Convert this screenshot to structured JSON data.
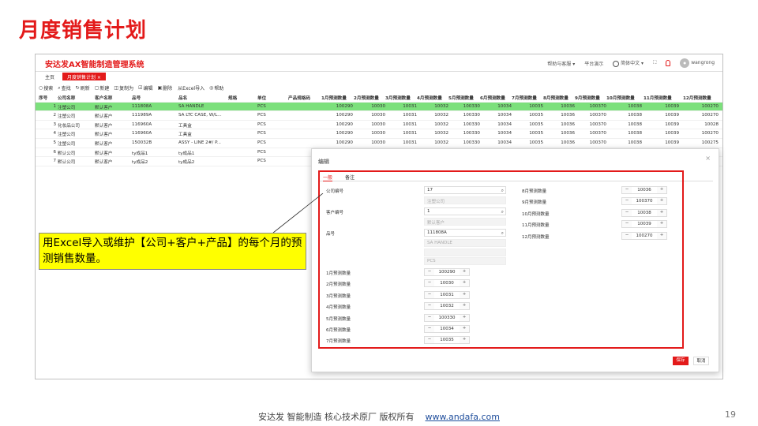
{
  "slide_title": "月度销售计划",
  "app": {
    "name": "安达发AX智能制造管理系统",
    "top_right": {
      "help": "帮助与客服 ▾",
      "platform": "平台演示",
      "lang": "简体中文 ▾",
      "user": "wangrong"
    },
    "tabs": [
      {
        "label": "主页"
      },
      {
        "label": "月度销售计划  ×"
      }
    ],
    "toolbar": [
      "搜索",
      "查找",
      "刷新",
      "新建",
      "复制为",
      "编辑",
      "删除",
      "从Excel导入",
      "帮助"
    ],
    "toolbar_icons": [
      "○",
      "⌕",
      "↻",
      "▢",
      "◫",
      "☑",
      "▣",
      "",
      "◎"
    ],
    "columns": [
      "序号",
      "公司名称",
      "客户名称",
      "品号",
      "品名",
      "规格",
      "单位",
      "产品规格码",
      "1月预测数量",
      "2月预测数量",
      "3月预测数量",
      "4月预测数量",
      "5月预测数量",
      "6月预测数量",
      "7月预测数量",
      "8月预测数量",
      "9月预测数量",
      "10月预测数量",
      "11月预测数量",
      "12月预测数量"
    ],
    "rows": [
      [
        "1",
        "注塑公司",
        "默认客户",
        "111808A",
        "SA HANDLE",
        "",
        "PCS",
        "",
        "100290",
        "10030",
        "10031",
        "10032",
        "100330",
        "10034",
        "10035",
        "10036",
        "100370",
        "10038",
        "10039",
        "100270"
      ],
      [
        "2",
        "注塑公司",
        "默认客户",
        "111989A",
        "SA LTC CASE, W/L...",
        "",
        "PCS",
        "",
        "100290",
        "10030",
        "10031",
        "10032",
        "100330",
        "10034",
        "10035",
        "10036",
        "100370",
        "10038",
        "10039",
        "100270"
      ],
      [
        "3",
        "化妆品公司",
        "默认客户",
        "116960A",
        "工具盒",
        "",
        "PCS",
        "",
        "100290",
        "10030",
        "10031",
        "10032",
        "100330",
        "10034",
        "10035",
        "10036",
        "100370",
        "10038",
        "10039",
        "10028"
      ],
      [
        "4",
        "注塑公司",
        "默认客户",
        "116960A",
        "工具盒",
        "",
        "PCS",
        "",
        "100290",
        "10030",
        "10031",
        "10032",
        "100330",
        "10034",
        "10035",
        "10036",
        "100370",
        "10038",
        "10039",
        "100270"
      ],
      [
        "5",
        "注塑公司",
        "默认客户",
        "150032B",
        "ASSY - LINE 2#/ P...",
        "",
        "PCS",
        "",
        "100290",
        "10030",
        "10031",
        "10032",
        "100330",
        "10034",
        "10035",
        "10036",
        "100370",
        "10038",
        "10039",
        "100275"
      ],
      [
        "6",
        "默认公司",
        "默认客户",
        "ty成品1",
        "ty成品1",
        "",
        "PCS",
        "",
        "",
        "",
        "",
        "",
        "",
        "",
        "",
        "",
        "",
        "",
        "",
        ""
      ],
      [
        "7",
        "默认公司",
        "默认客户",
        "ty成品2",
        "ty成品2",
        "",
        "PCS",
        "",
        "",
        "",
        "",
        "",
        "",
        "",
        "",
        "",
        "",
        "",
        "",
        ""
      ]
    ]
  },
  "dialog": {
    "title": "编辑",
    "close": "×",
    "tabs": [
      "一般",
      "备注"
    ],
    "company_label": "公司编号",
    "company_value": "17",
    "company_name": "注塑公司",
    "customer_label": "客户编号",
    "customer_value": "1",
    "customer_name": "默认客户",
    "item_label": "品号",
    "item_value": "111808A",
    "item_name": "SA HANDLE",
    "item_spec": "",
    "item_unit": "PCS",
    "months_left": [
      {
        "label": "1月预测数量",
        "value": "100290"
      },
      {
        "label": "2月预测数量",
        "value": "10030"
      },
      {
        "label": "3月预测数量",
        "value": "10031"
      },
      {
        "label": "4月预测数量",
        "value": "10032"
      },
      {
        "label": "5月预测数量",
        "value": "100330"
      },
      {
        "label": "6月预测数量",
        "value": "10034"
      },
      {
        "label": "7月预测数量",
        "value": "10035"
      }
    ],
    "months_right": [
      {
        "label": "8月预测数量",
        "value": "10036"
      },
      {
        "label": "9月预测数量",
        "value": "100370"
      },
      {
        "label": "10月预测数量",
        "value": "10038"
      },
      {
        "label": "11月预测数量",
        "value": "10039"
      },
      {
        "label": "12月预测数量",
        "value": "100270"
      }
    ],
    "save": "保存",
    "cancel": "取消"
  },
  "callout": "用Excel导入或维护【公司+客户+产品】的每个月的预测销售数量。",
  "footer": {
    "text": "安达发  智能制造 核心技术原厂  版权所有",
    "link": "www.andafa.com",
    "page": "19"
  },
  "colors": {
    "accent": "#e31a1a",
    "selected_row": "#7ce07c",
    "callout": "#ffff00"
  }
}
